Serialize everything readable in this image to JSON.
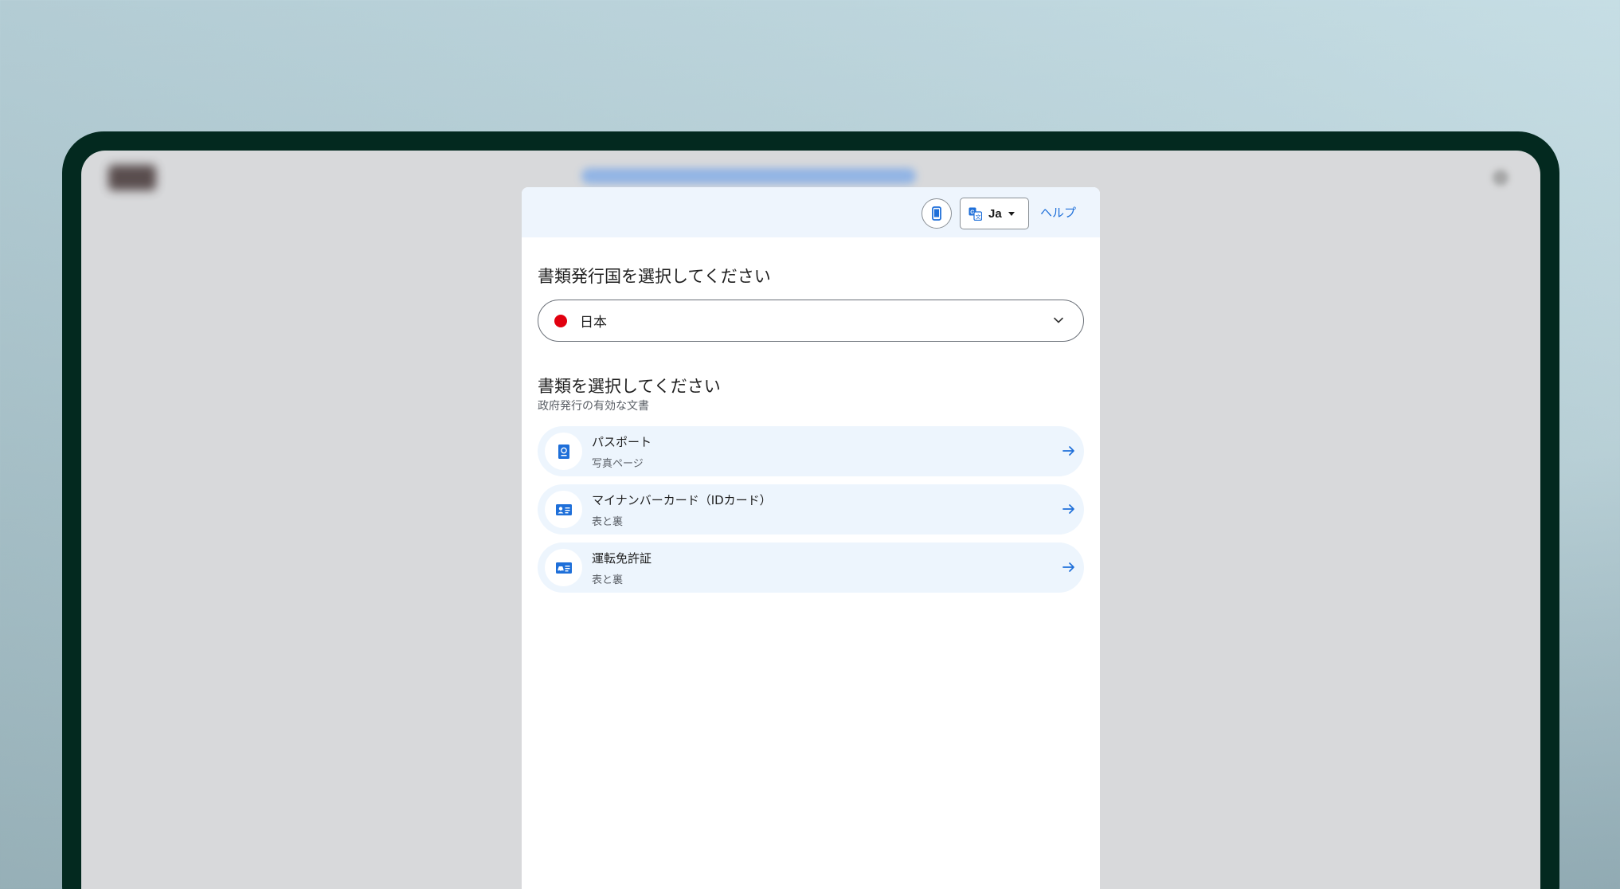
{
  "header": {
    "phone_icon": "smartphone-icon",
    "language": {
      "icon": "translate-icon",
      "label": "Ja"
    },
    "help_label": "ヘルプ"
  },
  "country_section": {
    "title": "書類発行国を選択してください",
    "selected_country": "日本",
    "flag_color": "#e1000f"
  },
  "document_section": {
    "title": "書類を選択してください",
    "subtitle": "政府発行の有効な文書",
    "items": [
      {
        "name": "パスポート",
        "detail": "写真ページ",
        "icon": "passport-icon"
      },
      {
        "name": "マイナンバーカード（IDカード）",
        "detail": "表と裏",
        "icon": "id-card-icon"
      },
      {
        "name": "運転免許証",
        "detail": "表と裏",
        "icon": "driving-license-icon"
      }
    ]
  },
  "colors": {
    "accent": "#1e6fd9",
    "device_frame": "#03291f",
    "panel_header": "#eef5fd",
    "item_background": "#edf5fd"
  }
}
